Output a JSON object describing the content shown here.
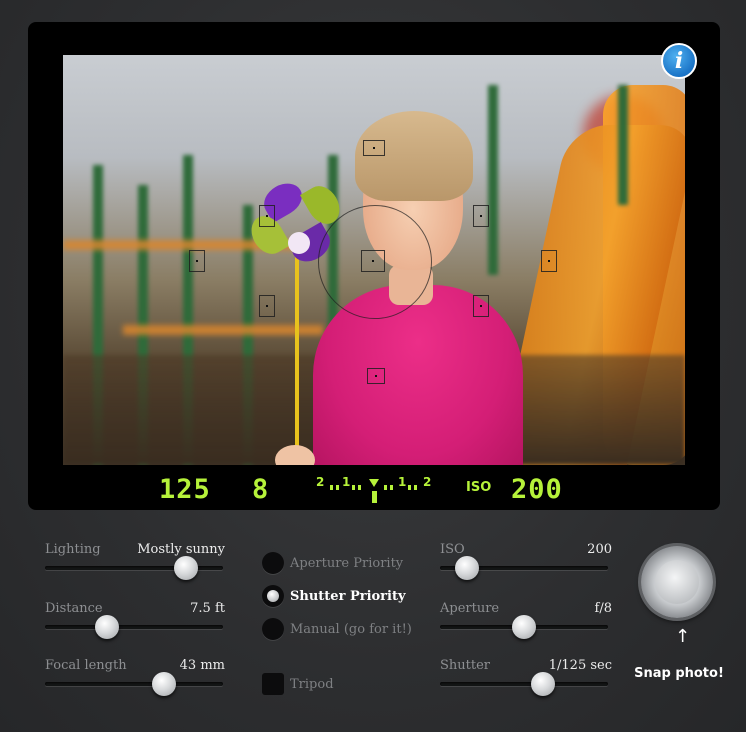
{
  "viewfinder": {
    "info_label": "i",
    "readout": {
      "shutter": "125",
      "aperture": "8",
      "meter_left": "2",
      "meter_left2": "1",
      "meter_right": "1",
      "meter_right2": "2",
      "iso_label": "ISO",
      "iso_value": "200"
    },
    "lcd_color": "#b6f23a"
  },
  "controls": {
    "lighting": {
      "label": "Lighting",
      "value": "Mostly sunny",
      "level": 0.8
    },
    "distance": {
      "label": "Distance",
      "value": "7.5 ft",
      "level": 0.35
    },
    "focal_length": {
      "label": "Focal length",
      "value": "43 mm",
      "level": 0.68
    },
    "iso": {
      "label": "ISO",
      "value": "200",
      "level": 0.15
    },
    "aperture": {
      "label": "Aperture",
      "value": "f/8",
      "level": 0.5
    },
    "shutter": {
      "label": "Shutter",
      "value": "1/125 sec",
      "level": 0.6
    }
  },
  "modes": {
    "aperture_priority": "Aperture Priority",
    "shutter_priority": "Shutter Priority",
    "manual": "Manual (go for it!)",
    "selected": "Shutter Priority",
    "tripod": "Tripod"
  },
  "snap": {
    "label": "Snap photo!",
    "arrow": "↑"
  }
}
